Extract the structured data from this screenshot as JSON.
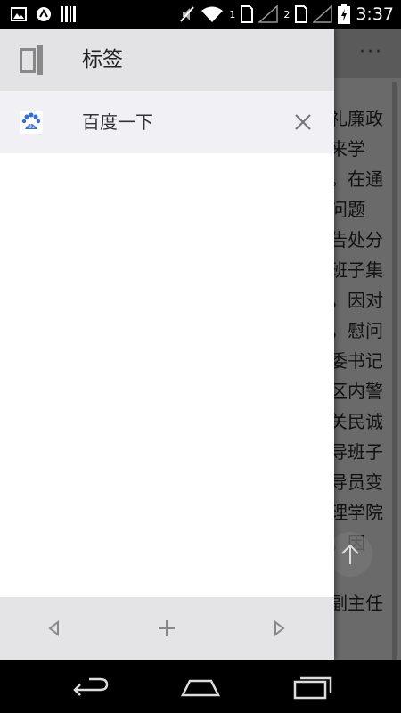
{
  "status_bar": {
    "sim1_label": "1",
    "sim2_label": "2",
    "time": "3:37",
    "icons": [
      "image-icon",
      "sync-icon",
      "barcode-icon",
      "mute-icon",
      "wifi-icon",
      "sim1-icon",
      "signal-icon",
      "sim2-icon",
      "signal-icon",
      "battery-charging-icon"
    ]
  },
  "background_page": {
    "menu_label": "···",
    "lines": [
      "礼廉政",
      "来学",
      "。在通",
      "问题",
      "告处分",
      "班子集",
      "，因对",
      "，慰问",
      "委书记",
      "区内警",
      "关民诚",
      "导班子",
      "导员变",
      "理学院",
      "。因",
      "",
      "副主任"
    ]
  },
  "drawer": {
    "title": "标签",
    "tabs": [
      {
        "title": "百度一下",
        "favicon": "baidu-icon"
      }
    ],
    "bottom_buttons": [
      "back-icon",
      "add-icon",
      "forward-icon"
    ]
  },
  "navigation_bar": {
    "buttons": [
      "back-nav-icon",
      "home-nav-icon",
      "recents-nav-icon"
    ]
  },
  "colors": {
    "drawer_header": "#e3e3e5",
    "tab_row": "#f1f0f5",
    "drawer_bottom": "#e4e4e6",
    "icon_gray": "#888888",
    "baidu_blue": "#2f6fe0"
  }
}
